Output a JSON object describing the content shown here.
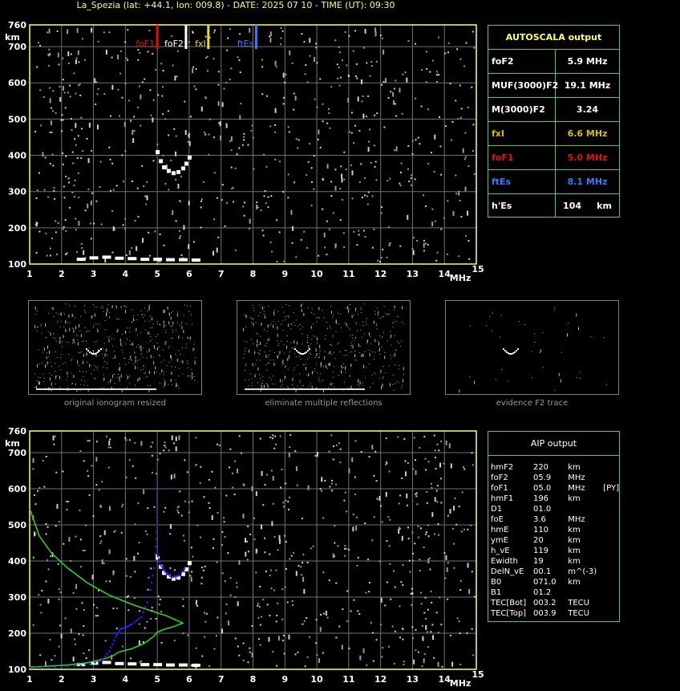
{
  "title": "La_Spezia (lat: +44.1, lon: 009.8) - DATE: 2025 07 10 - TIME (UT): 09:30",
  "colors": {
    "foF1": "#e01010",
    "foF2": "#ffffff",
    "fxI": "#e8e020",
    "ftEs": "#2a7fff",
    "grid": "#707070",
    "frame": "#ffff66",
    "profile": "#20e020",
    "trace": "#2020ff"
  },
  "chart_data": [
    {
      "type": "scatter",
      "name": "autoscaled ionogram",
      "x_unit": "MHz",
      "y_unit": "km",
      "xlim": [
        1,
        15
      ],
      "ylim": [
        100,
        760
      ],
      "x_ticks": [
        "1",
        "2",
        "3",
        "4",
        "5",
        "6",
        "7",
        "8",
        "9",
        "10",
        "11",
        "12",
        "13",
        "14",
        "15"
      ],
      "y_ticks": [
        "760",
        "700",
        "600",
        "500",
        "400",
        "300",
        "200",
        "100"
      ],
      "x_label": "MHz",
      "y_label": "km",
      "grid": true,
      "markers": [
        {
          "label": "foF1",
          "freq": 5.0,
          "color": "#e01010"
        },
        {
          "label": "foF2",
          "freq": 5.9,
          "color": "#ffffff"
        },
        {
          "label": "fxI",
          "freq": 6.6,
          "color": "#e8e020"
        },
        {
          "label": "ftEs",
          "freq": 8.1,
          "color": "#2a7fff"
        }
      ],
      "f2_trace": [
        [
          5.0,
          410
        ],
        [
          5.1,
          385
        ],
        [
          5.2,
          368
        ],
        [
          5.35,
          358
        ],
        [
          5.5,
          352
        ],
        [
          5.65,
          355
        ],
        [
          5.8,
          365
        ],
        [
          5.9,
          378
        ],
        [
          6.0,
          395
        ]
      ],
      "es_trace": [
        [
          2.6,
          113
        ],
        [
          3.0,
          117
        ],
        [
          3.4,
          119
        ],
        [
          3.8,
          116
        ],
        [
          4.2,
          115
        ],
        [
          4.6,
          113
        ],
        [
          5.0,
          113
        ],
        [
          5.4,
          112
        ],
        [
          5.8,
          112
        ],
        [
          6.2,
          111
        ]
      ]
    },
    {
      "type": "line",
      "name": "AIP profile",
      "x_unit": "MHz",
      "y_unit": "km",
      "xlim": [
        1,
        15
      ],
      "ylim": [
        100,
        760
      ],
      "series": [
        {
          "color": "#20e020",
          "points": [
            [
              1,
              545
            ],
            [
              1.3,
              470
            ],
            [
              1.7,
              420
            ],
            [
              2.2,
              380
            ],
            [
              2.8,
              340
            ],
            [
              3.5,
              305
            ],
            [
              4.2,
              280
            ],
            [
              4.8,
              262
            ],
            [
              5.3,
              248
            ],
            [
              5.7,
              232
            ],
            [
              5.8,
              228
            ],
            [
              5.5,
              218
            ],
            [
              5.2,
              210
            ],
            [
              5.0,
              203
            ],
            [
              4.9,
              192
            ],
            [
              4.6,
              172
            ],
            [
              4.2,
              157
            ],
            [
              3.8,
              148
            ],
            [
              3.6,
              137
            ],
            [
              3.3,
              128
            ],
            [
              2.8,
              118
            ],
            [
              2.2,
              112
            ],
            [
              1.5,
              108
            ],
            [
              1,
              106
            ]
          ]
        },
        {
          "color": "#2020ff",
          "points": [
            [
              1,
              105
            ],
            [
              1.8,
              106
            ],
            [
              2.6,
              110
            ],
            [
              3.2,
              122
            ],
            [
              3.5,
              150
            ],
            [
              3.7,
              190
            ],
            [
              3.85,
              212
            ],
            [
              4.0,
              215
            ],
            [
              4.2,
              225
            ],
            [
              4.5,
              245
            ],
            [
              4.75,
              300
            ],
            [
              4.9,
              380
            ],
            [
              4.97,
              460
            ],
            [
              5.0,
              540
            ],
            [
              5.0,
              640
            ]
          ]
        },
        {
          "color": "#2020ff",
          "points": [
            [
              5.0,
              420
            ],
            [
              5.1,
              390
            ],
            [
              5.25,
              370
            ],
            [
              5.45,
              355
            ],
            [
              5.7,
              360
            ],
            [
              5.9,
              385
            ]
          ]
        }
      ]
    }
  ],
  "autoscala": {
    "header": "AUTOSCALA output",
    "rows": [
      {
        "name": "foF2",
        "value": "5.9 MHz",
        "color": "#ffffff"
      },
      {
        "name": "MUF(3000)F2",
        "value": "19.1 MHz",
        "color": "#ffffff"
      },
      {
        "name": "M(3000)F2",
        "value": "3.24",
        "color": "#ffffff"
      },
      {
        "name": "fxI",
        "value": "6.6 MHz",
        "color": "#d8c000"
      },
      {
        "name": "foF1",
        "value": "5.0 MHz",
        "color": "#e01010"
      },
      {
        "name": "ftEs",
        "value": "8.1 MHz",
        "color": "#2a7fff"
      },
      {
        "name": "h'Es",
        "value": "104     km",
        "color": "#ffffff"
      }
    ]
  },
  "aip": {
    "header": "AIP output",
    "rows": [
      [
        "hmF2",
        "220",
        "km",
        ""
      ],
      [
        "foF2",
        "05.9",
        "MHz",
        ""
      ],
      [
        "foF1",
        "05.0",
        "MHz",
        "[PY]"
      ],
      [
        "hmF1",
        "196",
        "km",
        ""
      ],
      [
        "D1",
        "01.0",
        "",
        ""
      ],
      [
        "foE",
        "3.6",
        "MHz",
        ""
      ],
      [
        "hmE",
        "110",
        "km",
        ""
      ],
      [
        "ymE",
        "20",
        "km",
        ""
      ],
      [
        "h_vE",
        "119",
        "km",
        ""
      ],
      [
        "Ewidth",
        "19",
        "km",
        ""
      ],
      [
        "DelN_vE",
        "00.1",
        "m^(-3)",
        ""
      ],
      [
        "B0",
        "071.0",
        "km",
        ""
      ],
      [
        "B1",
        "01.2",
        "",
        ""
      ],
      [
        "TEC[Bot]",
        "003.2",
        "TECU",
        ""
      ],
      [
        "TEC[Top]",
        "003.9",
        "TECU",
        ""
      ]
    ]
  },
  "thumbnails": [
    {
      "caption": "original ionogram resized"
    },
    {
      "caption": "eliminate multiple reflections"
    },
    {
      "caption": "evidence F2 trace"
    }
  ]
}
